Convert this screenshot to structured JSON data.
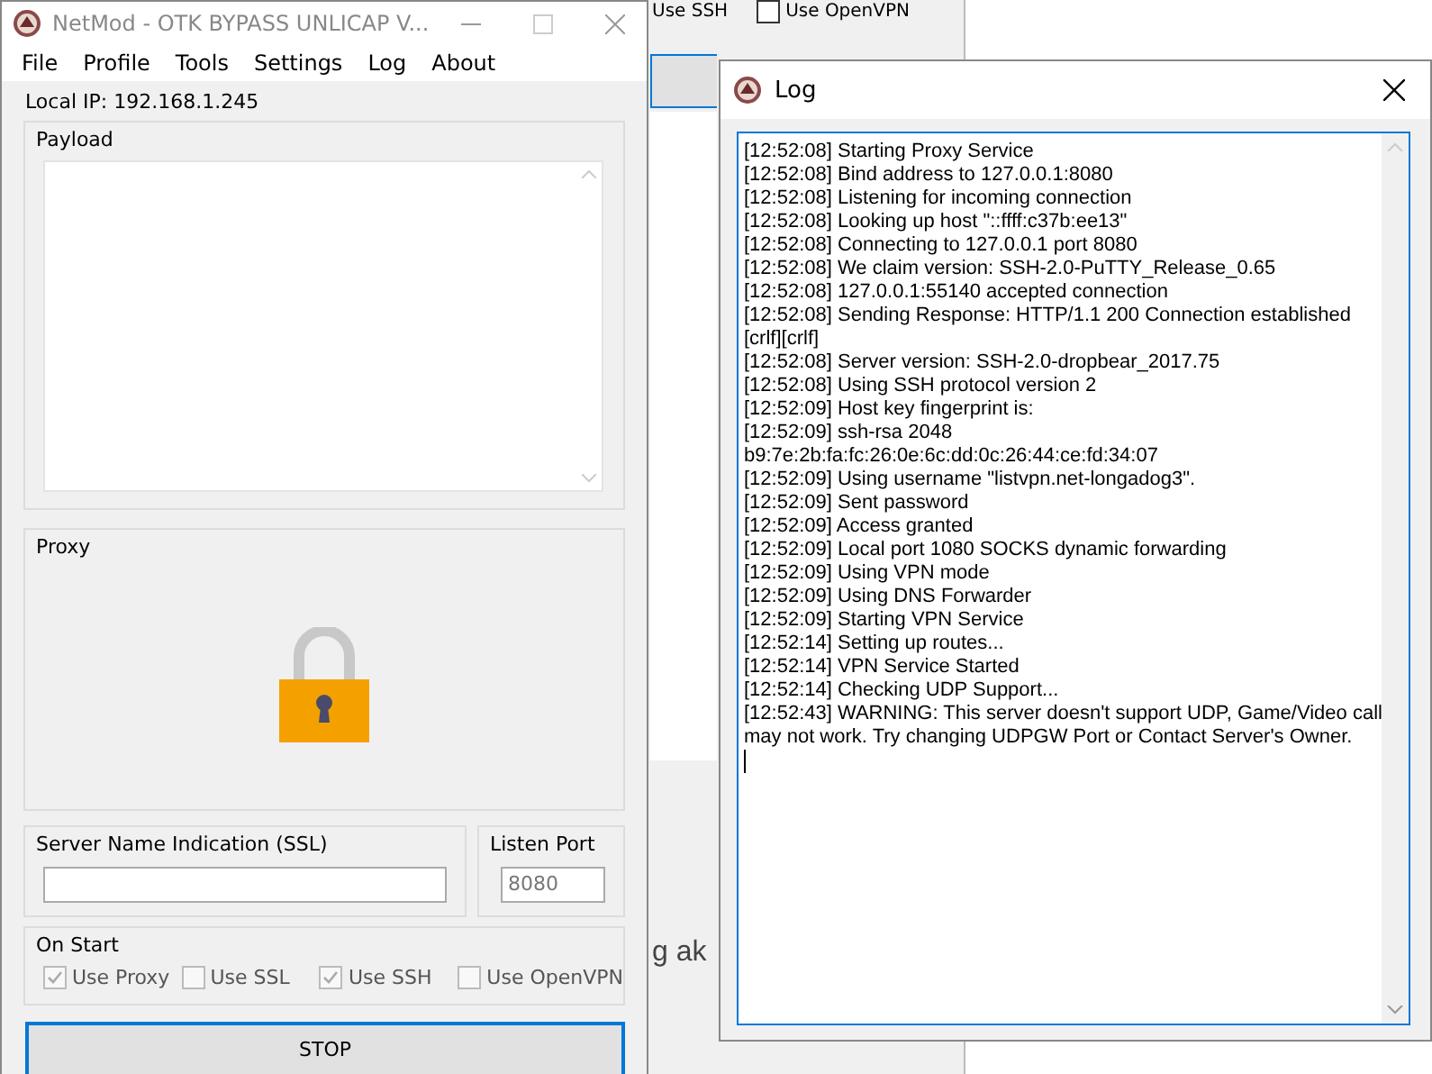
{
  "background": {
    "checkboxes": [
      {
        "label": "Use SSH"
      },
      {
        "label": "Use OpenVPN",
        "checked": false
      }
    ],
    "text": "g ak"
  },
  "main_window": {
    "title": "NetMod - OTK BYPASS UNLICAP V...",
    "menu": [
      "File",
      "Profile",
      "Tools",
      "Settings",
      "Log",
      "About"
    ],
    "local_ip": "Local IP: 192.168.1.245",
    "payload": {
      "label": "Payload"
    },
    "proxy": {
      "label": "Proxy"
    },
    "sni": {
      "label": "Server Name Indication (SSL)"
    },
    "listen_port": {
      "label": "Listen Port",
      "value": "8080"
    },
    "on_start": {
      "label": "On Start",
      "options": [
        {
          "label": "Use Proxy",
          "checked": true
        },
        {
          "label": "Use SSL",
          "checked": false
        },
        {
          "label": "Use SSH",
          "checked": true
        },
        {
          "label": "Use OpenVPN",
          "checked": false
        }
      ]
    },
    "button": "STOP"
  },
  "log_window": {
    "title": "Log",
    "lines": [
      "[12:52:08] Starting Proxy Service",
      "[12:52:08] Bind address to 127.0.0.1:8080",
      "[12:52:08] Listening for incoming connection",
      "[12:52:08] Looking up host \"::ffff:c37b:ee13\"",
      "[12:52:08] Connecting to 127.0.0.1 port 8080",
      "[12:52:08] We claim version: SSH-2.0-PuTTY_Release_0.65",
      "[12:52:08] 127.0.0.1:55140 accepted connection",
      "[12:52:08] Sending Response: HTTP/1.1 200 Connection established",
      "[crlf][crlf]",
      "[12:52:08] Server version: SSH-2.0-dropbear_2017.75",
      "[12:52:08] Using SSH protocol version 2",
      "[12:52:09] Host key fingerprint is:",
      "[12:52:09] ssh-rsa 2048",
      "b9:7e:2b:fa:fc:26:0e:6c:dd:0c:26:44:ce:fd:34:07",
      "[12:52:09] Using username \"listvpn.net-longadog3\".",
      "[12:52:09] Sent password",
      "[12:52:09] Access granted",
      "[12:52:09] Local port 1080 SOCKS dynamic forwarding",
      "[12:52:09] Using VPN mode",
      "[12:52:09] Using DNS Forwarder",
      "[12:52:09] Starting VPN Service",
      "[12:52:14] Setting up routes...",
      "[12:52:14] VPN Service Started",
      "[12:52:14] Checking UDP Support...",
      "[12:52:43] WARNING: This server doesn't support UDP, Game/Video call",
      "may not work. Try changing UDPGW Port or Contact Server's Owner."
    ]
  }
}
